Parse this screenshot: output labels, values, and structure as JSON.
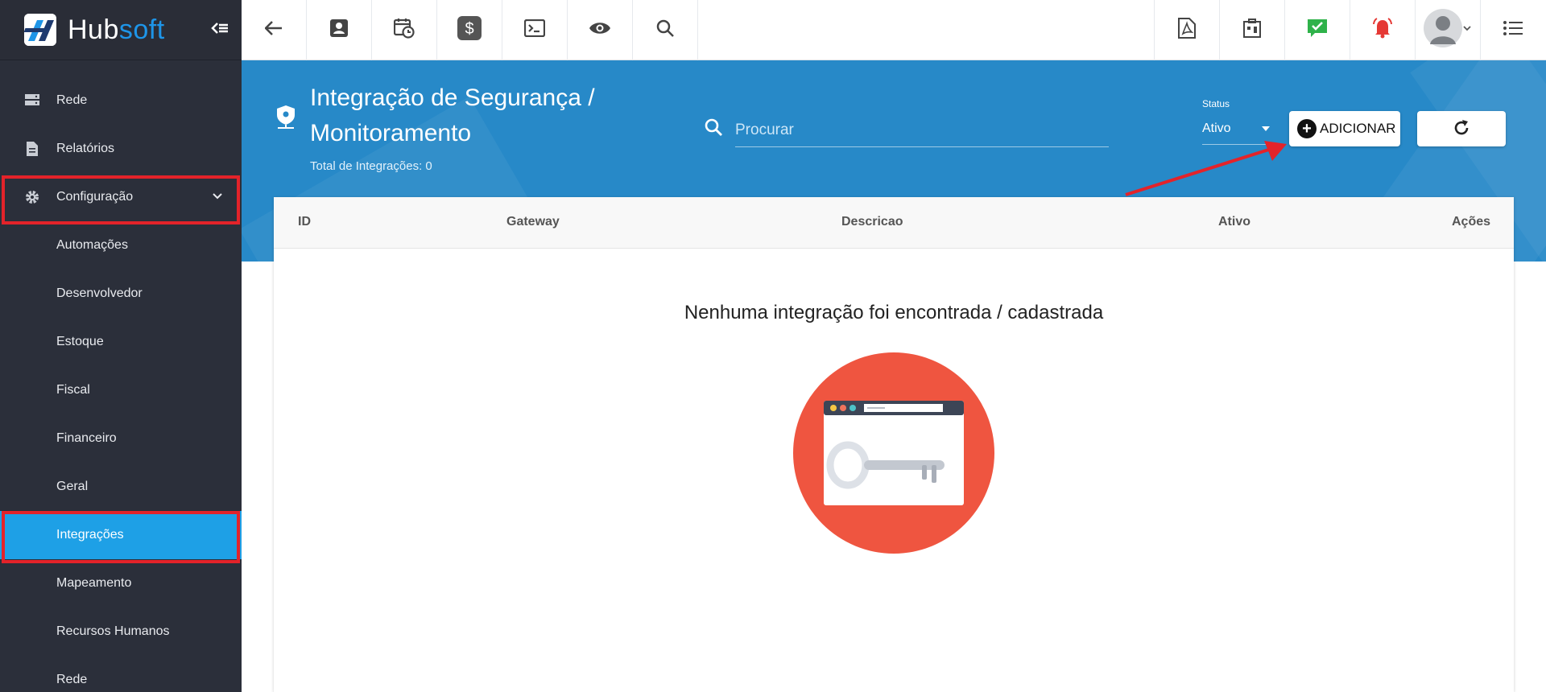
{
  "brand": {
    "name_part1": "Hub",
    "name_part2": "soft",
    "logo_icon": "hubsoft-logo-icon",
    "collapse_icon": "collapse-menu-icon"
  },
  "sidebar": {
    "items": [
      {
        "label": "Rede",
        "icon": "server-icon"
      },
      {
        "label": "Relatórios",
        "icon": "report-icon"
      },
      {
        "label": "Configuração",
        "icon": "gear-icon",
        "expanded": true
      },
      {
        "label": "Automações"
      },
      {
        "label": "Desenvolvedor"
      },
      {
        "label": "Estoque"
      },
      {
        "label": "Fiscal"
      },
      {
        "label": "Financeiro"
      },
      {
        "label": "Geral"
      },
      {
        "label": "Integrações",
        "active": true
      },
      {
        "label": "Mapeamento"
      },
      {
        "label": "Recursos Humanos"
      },
      {
        "label": "Rede"
      }
    ]
  },
  "topbar": {
    "left_icons": [
      "back-arrow-icon",
      "contact-card-icon",
      "calendar-clock-icon",
      "dollar-icon",
      "terminal-icon",
      "eye-icon",
      "search-icon"
    ],
    "right_icons": [
      "pdf-icon",
      "building-icon",
      "chat-check-icon",
      "alarm-bell-icon",
      "user-avatar-icon",
      "list-menu-icon"
    ]
  },
  "header": {
    "title": "Integração de Segurança / Monitoramento",
    "subtitle": "Total de Integrações: 0",
    "search_placeholder": "Procurar",
    "status_label": "Status",
    "status_value": "Ativo",
    "add_label": "ADICIONAR"
  },
  "table": {
    "columns": [
      "ID",
      "Gateway",
      "Descricao",
      "Ativo",
      "Ações"
    ],
    "rows": [],
    "empty_message": "Nenhuma integração foi encontrada / cadastrada"
  },
  "colors": {
    "sidebar_bg": "#2b2f3a",
    "active_item": "#1ea0e6",
    "header_blue": "#2789c8",
    "highlight_red": "#e3232a",
    "illustration_red": "#ef5540"
  }
}
